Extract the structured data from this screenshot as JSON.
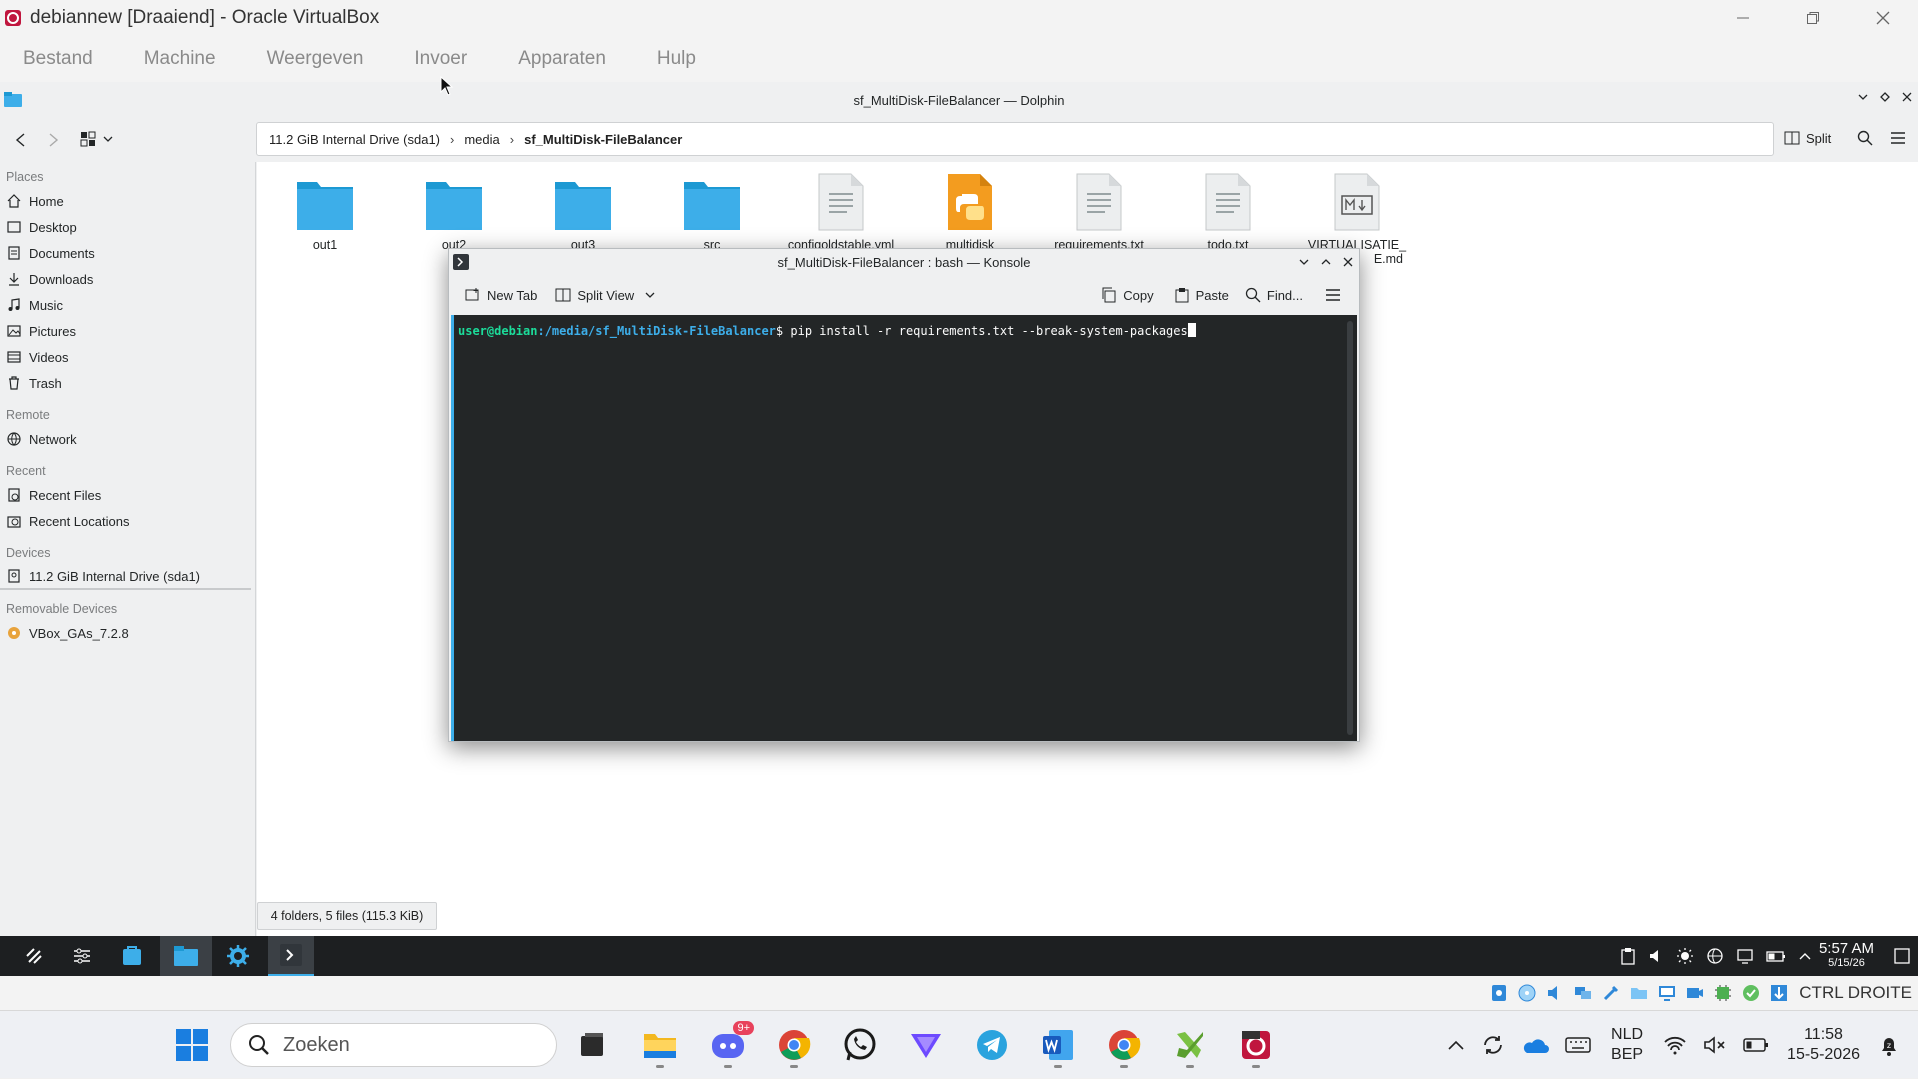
{
  "vbox": {
    "title": "debiannew [Draaiend] - Oracle VirtualBox",
    "menu": [
      "Bestand",
      "Machine",
      "Weergeven",
      "Invoer",
      "Apparaten",
      "Hulp"
    ],
    "host_key": "CTRL DROITE"
  },
  "dolphin": {
    "title": "sf_MultiDisk-FileBalancer — Dolphin",
    "breadcrumb": [
      "11.2 GiB Internal Drive (sda1)",
      "media",
      "sf_MultiDisk-FileBalancer"
    ],
    "split_label": "Split",
    "places": {
      "places_header": "Places",
      "items": [
        {
          "label": "Home",
          "icon": "home-icon"
        },
        {
          "label": "Desktop",
          "icon": "desktop-icon"
        },
        {
          "label": "Documents",
          "icon": "documents-icon"
        },
        {
          "label": "Downloads",
          "icon": "downloads-icon"
        },
        {
          "label": "Music",
          "icon": "music-icon"
        },
        {
          "label": "Pictures",
          "icon": "pictures-icon"
        },
        {
          "label": "Videos",
          "icon": "videos-icon"
        },
        {
          "label": "Trash",
          "icon": "trash-icon"
        }
      ],
      "remote_header": "Remote",
      "remote": [
        {
          "label": "Network",
          "icon": "network-icon"
        }
      ],
      "recent_header": "Recent",
      "recent": [
        {
          "label": "Recent Files",
          "icon": "recent-files-icon"
        },
        {
          "label": "Recent Locations",
          "icon": "recent-locations-icon"
        }
      ],
      "devices_header": "Devices",
      "devices": [
        {
          "label": "11.2 GiB Internal Drive (sda1)",
          "icon": "drive-icon"
        }
      ],
      "removable_header": "Removable Devices",
      "removable": [
        {
          "label": "VBox_GAs_7.2.8",
          "icon": "disc-icon"
        }
      ]
    },
    "files": [
      {
        "name": "out1",
        "type": "folder"
      },
      {
        "name": "out2",
        "type": "folder"
      },
      {
        "name": "out3",
        "type": "folder"
      },
      {
        "name": "src",
        "type": "folder"
      },
      {
        "name": "configoldstable.yml",
        "type": "text"
      },
      {
        "name": "multidisk",
        "type": "python"
      },
      {
        "name": "requirements.txt",
        "type": "text"
      },
      {
        "name": "todo.txt",
        "type": "text"
      },
      {
        "name": "VIRTUALISATIE_",
        "name2": "E.md",
        "type": "markdown"
      }
    ],
    "status": "4 folders, 5 files (115.3 KiB)"
  },
  "konsole": {
    "title": "sf_MultiDisk-FileBalancer : bash — Konsole",
    "new_tab": "New Tab",
    "split_view": "Split View",
    "copy": "Copy",
    "paste": "Paste",
    "find": "Find...",
    "prompt_user": "user@debian",
    "prompt_path": ":/media/sf_MultiDisk-FileBalancer",
    "prompt_symbol": "$",
    "command": " pip install -r requirements.txt --break-system-packages"
  },
  "guest_taskbar": {
    "time": "5:57 AM",
    "date": "5/15/26"
  },
  "windows": {
    "search_placeholder": "Zoeken",
    "lang_top": "NLD",
    "lang_bottom": "BEP",
    "time": "11:58",
    "date": "15-5-2026",
    "discord_badge": "9+"
  },
  "colors": {
    "folder": "#3daee9",
    "terminal_bg": "#232627",
    "prompt_user": "#1cdc9a",
    "prompt_path": "#3daee9",
    "guest_taskbar": "#1d1f21"
  }
}
